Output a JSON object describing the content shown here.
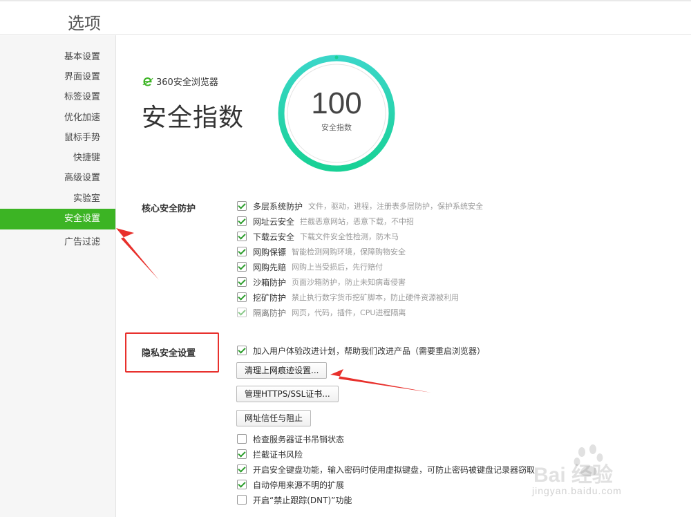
{
  "window": {
    "title": "选项"
  },
  "sidebar": {
    "items": [
      {
        "label": "基本设置"
      },
      {
        "label": "界面设置"
      },
      {
        "label": "标签设置"
      },
      {
        "label": "优化加速"
      },
      {
        "label": "鼠标手势"
      },
      {
        "label": "快捷键"
      },
      {
        "label": "高级设置"
      },
      {
        "label": "实验室"
      },
      {
        "label": "安全设置",
        "active": true
      },
      {
        "label": "广告过滤"
      }
    ]
  },
  "header": {
    "brand_name": "360安全浏览器",
    "title": "安全指数",
    "score": "100",
    "score_label": "安全指数",
    "accent_color": "#3cb424",
    "gauge_colors": [
      "#18d195",
      "#3ad6c8"
    ]
  },
  "core": {
    "label": "核心安全防护",
    "items": [
      {
        "name": "多层系统防护",
        "desc": "文件，驱动，进程，注册表多层防护，保护系统安全",
        "checked": true
      },
      {
        "name": "网址云安全",
        "desc": "拦截恶意网站，恶意下载，不中招",
        "checked": true
      },
      {
        "name": "下载云安全",
        "desc": "下载文件安全性检测，防木马",
        "checked": true
      },
      {
        "name": "网购保镖",
        "desc": "智能检测网购环境，保障购物安全",
        "checked": true
      },
      {
        "name": "网购先赔",
        "desc": "网购上当受损后，先行赔付",
        "checked": true
      },
      {
        "name": "沙箱防护",
        "desc": "页面沙箱防护，防止未知病毒侵害",
        "checked": true
      },
      {
        "name": "挖矿防护",
        "desc": "禁止执行数字货币挖矿脚本，防止硬件资源被利用",
        "checked": true
      },
      {
        "name": "隔离防护",
        "desc": "网页，代码，插件，CPU进程隔离",
        "checked": true,
        "disabled": true
      }
    ]
  },
  "privacy": {
    "label": "隐私安全设置",
    "join_program": {
      "label": "加入用户体验改进计划，帮助我们改进产品（需要重启浏览器）",
      "checked": true
    },
    "buttons": {
      "clear_history": "清理上网痕迹设置...",
      "manage_cert": "管理HTTPS/SSL证书...",
      "url_trust": "网址信任与阻止"
    },
    "options": [
      {
        "label": "检查服务器证书吊销状态",
        "checked": false
      },
      {
        "label": "拦截证书风险",
        "checked": true
      },
      {
        "label": "开启安全键盘功能，输入密码时使用虚拟键盘，可防止密码被键盘记录器窃取",
        "checked": true
      },
      {
        "label": "自动停用来源不明的扩展",
        "checked": true
      },
      {
        "label": "开启“禁止跟踪(DNT)”功能",
        "checked": false
      }
    ]
  },
  "watermark": {
    "brand": "Bai 经验",
    "url": "jingyan.baidu.com"
  },
  "annotation_color": "#e8302c"
}
